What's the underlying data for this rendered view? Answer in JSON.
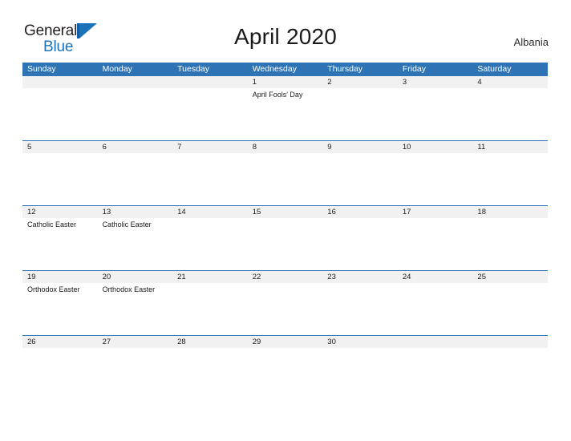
{
  "brand": {
    "name_part1": "General",
    "name_part2": "Blue",
    "mark": "blue-triangle-flag-icon",
    "color_dark": "#231f20",
    "color_blue": "#1c72b8"
  },
  "header": {
    "title": "April 2020",
    "country": "Albania"
  },
  "theme": {
    "header_blue": "#2e74b5",
    "band_gray": "#f1f1f1",
    "text": "#1a1a1a",
    "page_background": "#ffffff"
  },
  "calendar": {
    "month": "April",
    "year": "2020",
    "weekday_headers": [
      "Sunday",
      "Monday",
      "Tuesday",
      "Wednesday",
      "Thursday",
      "Friday",
      "Saturday"
    ],
    "weeks": [
      [
        {
          "day": "",
          "events": []
        },
        {
          "day": "",
          "events": []
        },
        {
          "day": "",
          "events": []
        },
        {
          "day": "1",
          "events": [
            "April Fools' Day"
          ]
        },
        {
          "day": "2",
          "events": []
        },
        {
          "day": "3",
          "events": []
        },
        {
          "day": "4",
          "events": []
        }
      ],
      [
        {
          "day": "5",
          "events": []
        },
        {
          "day": "6",
          "events": []
        },
        {
          "day": "7",
          "events": []
        },
        {
          "day": "8",
          "events": []
        },
        {
          "day": "9",
          "events": []
        },
        {
          "day": "10",
          "events": []
        },
        {
          "day": "11",
          "events": []
        }
      ],
      [
        {
          "day": "12",
          "events": [
            "Catholic Easter"
          ]
        },
        {
          "day": "13",
          "events": [
            "Catholic Easter"
          ]
        },
        {
          "day": "14",
          "events": []
        },
        {
          "day": "15",
          "events": []
        },
        {
          "day": "16",
          "events": []
        },
        {
          "day": "17",
          "events": []
        },
        {
          "day": "18",
          "events": []
        }
      ],
      [
        {
          "day": "19",
          "events": [
            "Orthodox Easter"
          ]
        },
        {
          "day": "20",
          "events": [
            "Orthodox Easter"
          ]
        },
        {
          "day": "21",
          "events": []
        },
        {
          "day": "22",
          "events": []
        },
        {
          "day": "23",
          "events": []
        },
        {
          "day": "24",
          "events": []
        },
        {
          "day": "25",
          "events": []
        }
      ],
      [
        {
          "day": "26",
          "events": []
        },
        {
          "day": "27",
          "events": []
        },
        {
          "day": "28",
          "events": []
        },
        {
          "day": "29",
          "events": []
        },
        {
          "day": "30",
          "events": []
        },
        {
          "day": "",
          "events": []
        },
        {
          "day": "",
          "events": []
        }
      ]
    ]
  }
}
